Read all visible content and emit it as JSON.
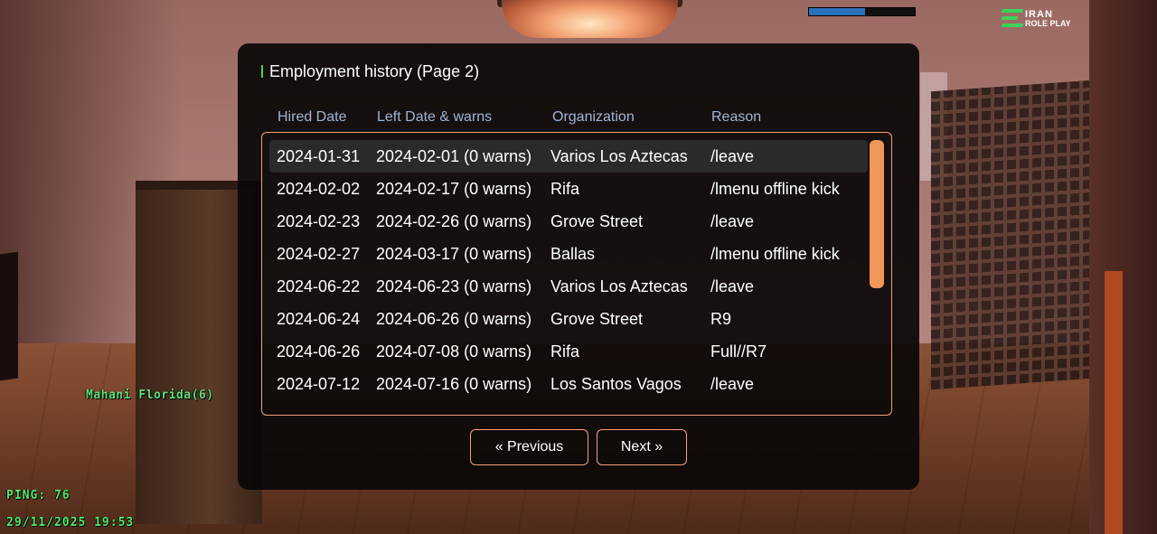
{
  "hud": {
    "health_fraction": 0.53,
    "logo_line1": "IRAN",
    "logo_line2": "ROLE PLAY",
    "player_name": "Mahani Florida(6)",
    "ping": "PING: 76",
    "datetime": "29/11/2025 19:53"
  },
  "dialog": {
    "title": "Employment history (Page 2)",
    "columns": [
      "Hired Date",
      "Left Date & warns",
      "Organization",
      "Reason"
    ],
    "rows": [
      {
        "hired": "2024-01-31",
        "left": "2024-02-01 (0 warns)",
        "org": "Varios Los Aztecas",
        "reason": "/leave"
      },
      {
        "hired": "2024-02-02",
        "left": "2024-02-17 (0 warns)",
        "org": "Rifa",
        "reason": "/lmenu offline kick"
      },
      {
        "hired": "2024-02-23",
        "left": "2024-02-26 (0 warns)",
        "org": "Grove Street",
        "reason": "/leave"
      },
      {
        "hired": "2024-02-27",
        "left": "2024-03-17 (0 warns)",
        "org": "Ballas",
        "reason": "/lmenu offline kick"
      },
      {
        "hired": "2024-06-22",
        "left": "2024-06-23 (0 warns)",
        "org": "Varios Los Aztecas",
        "reason": "/leave"
      },
      {
        "hired": "2024-06-24",
        "left": "2024-06-26 (0 warns)",
        "org": "Grove Street",
        "reason": "R9"
      },
      {
        "hired": "2024-06-26",
        "left": "2024-07-08 (0 warns)",
        "org": "Rifa",
        "reason": "Full//R7"
      },
      {
        "hired": "2024-07-12",
        "left": "2024-07-16 (0 warns)",
        "org": "Los Santos Vagos",
        "reason": "/leave"
      }
    ],
    "selected_row": 0,
    "prev_label": "« Previous",
    "next_label": "Next »"
  },
  "colors": {
    "accent_border": "#f4a07a",
    "scrollbar": "#f0965a",
    "header_text": "#9fb6d6",
    "hud_green": "#4ef06a",
    "title_accent": "#39d35a"
  }
}
